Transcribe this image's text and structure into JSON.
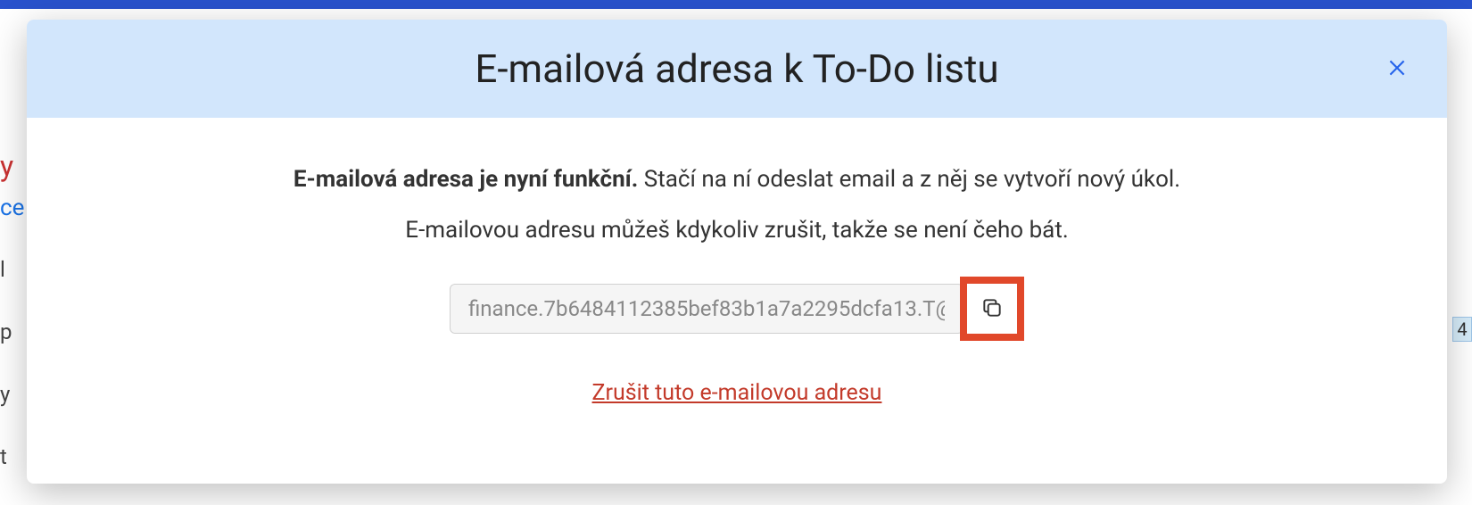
{
  "modal": {
    "title": "E-mailová adresa k To-Do listu",
    "description": {
      "line1_bold": "E-mailová adresa je nyní funkční.",
      "line1_rest": " Stačí na ní odeslat email a z něj se vytvoří nový úkol.",
      "line2": "E-mailovou adresu můžeš kdykoliv zrušit, takže se není čeho bát."
    },
    "email_value": "finance.7b6484112385bef83b1a7a2295dcfa13.T@",
    "cancel_label": "Zrušit tuto e-mailovou adresu"
  },
  "background": {
    "y": "y",
    "ce": "ce",
    "l1": "l",
    "l2": "p",
    "l3": "y",
    "l4": "t",
    "right_box": "4"
  }
}
